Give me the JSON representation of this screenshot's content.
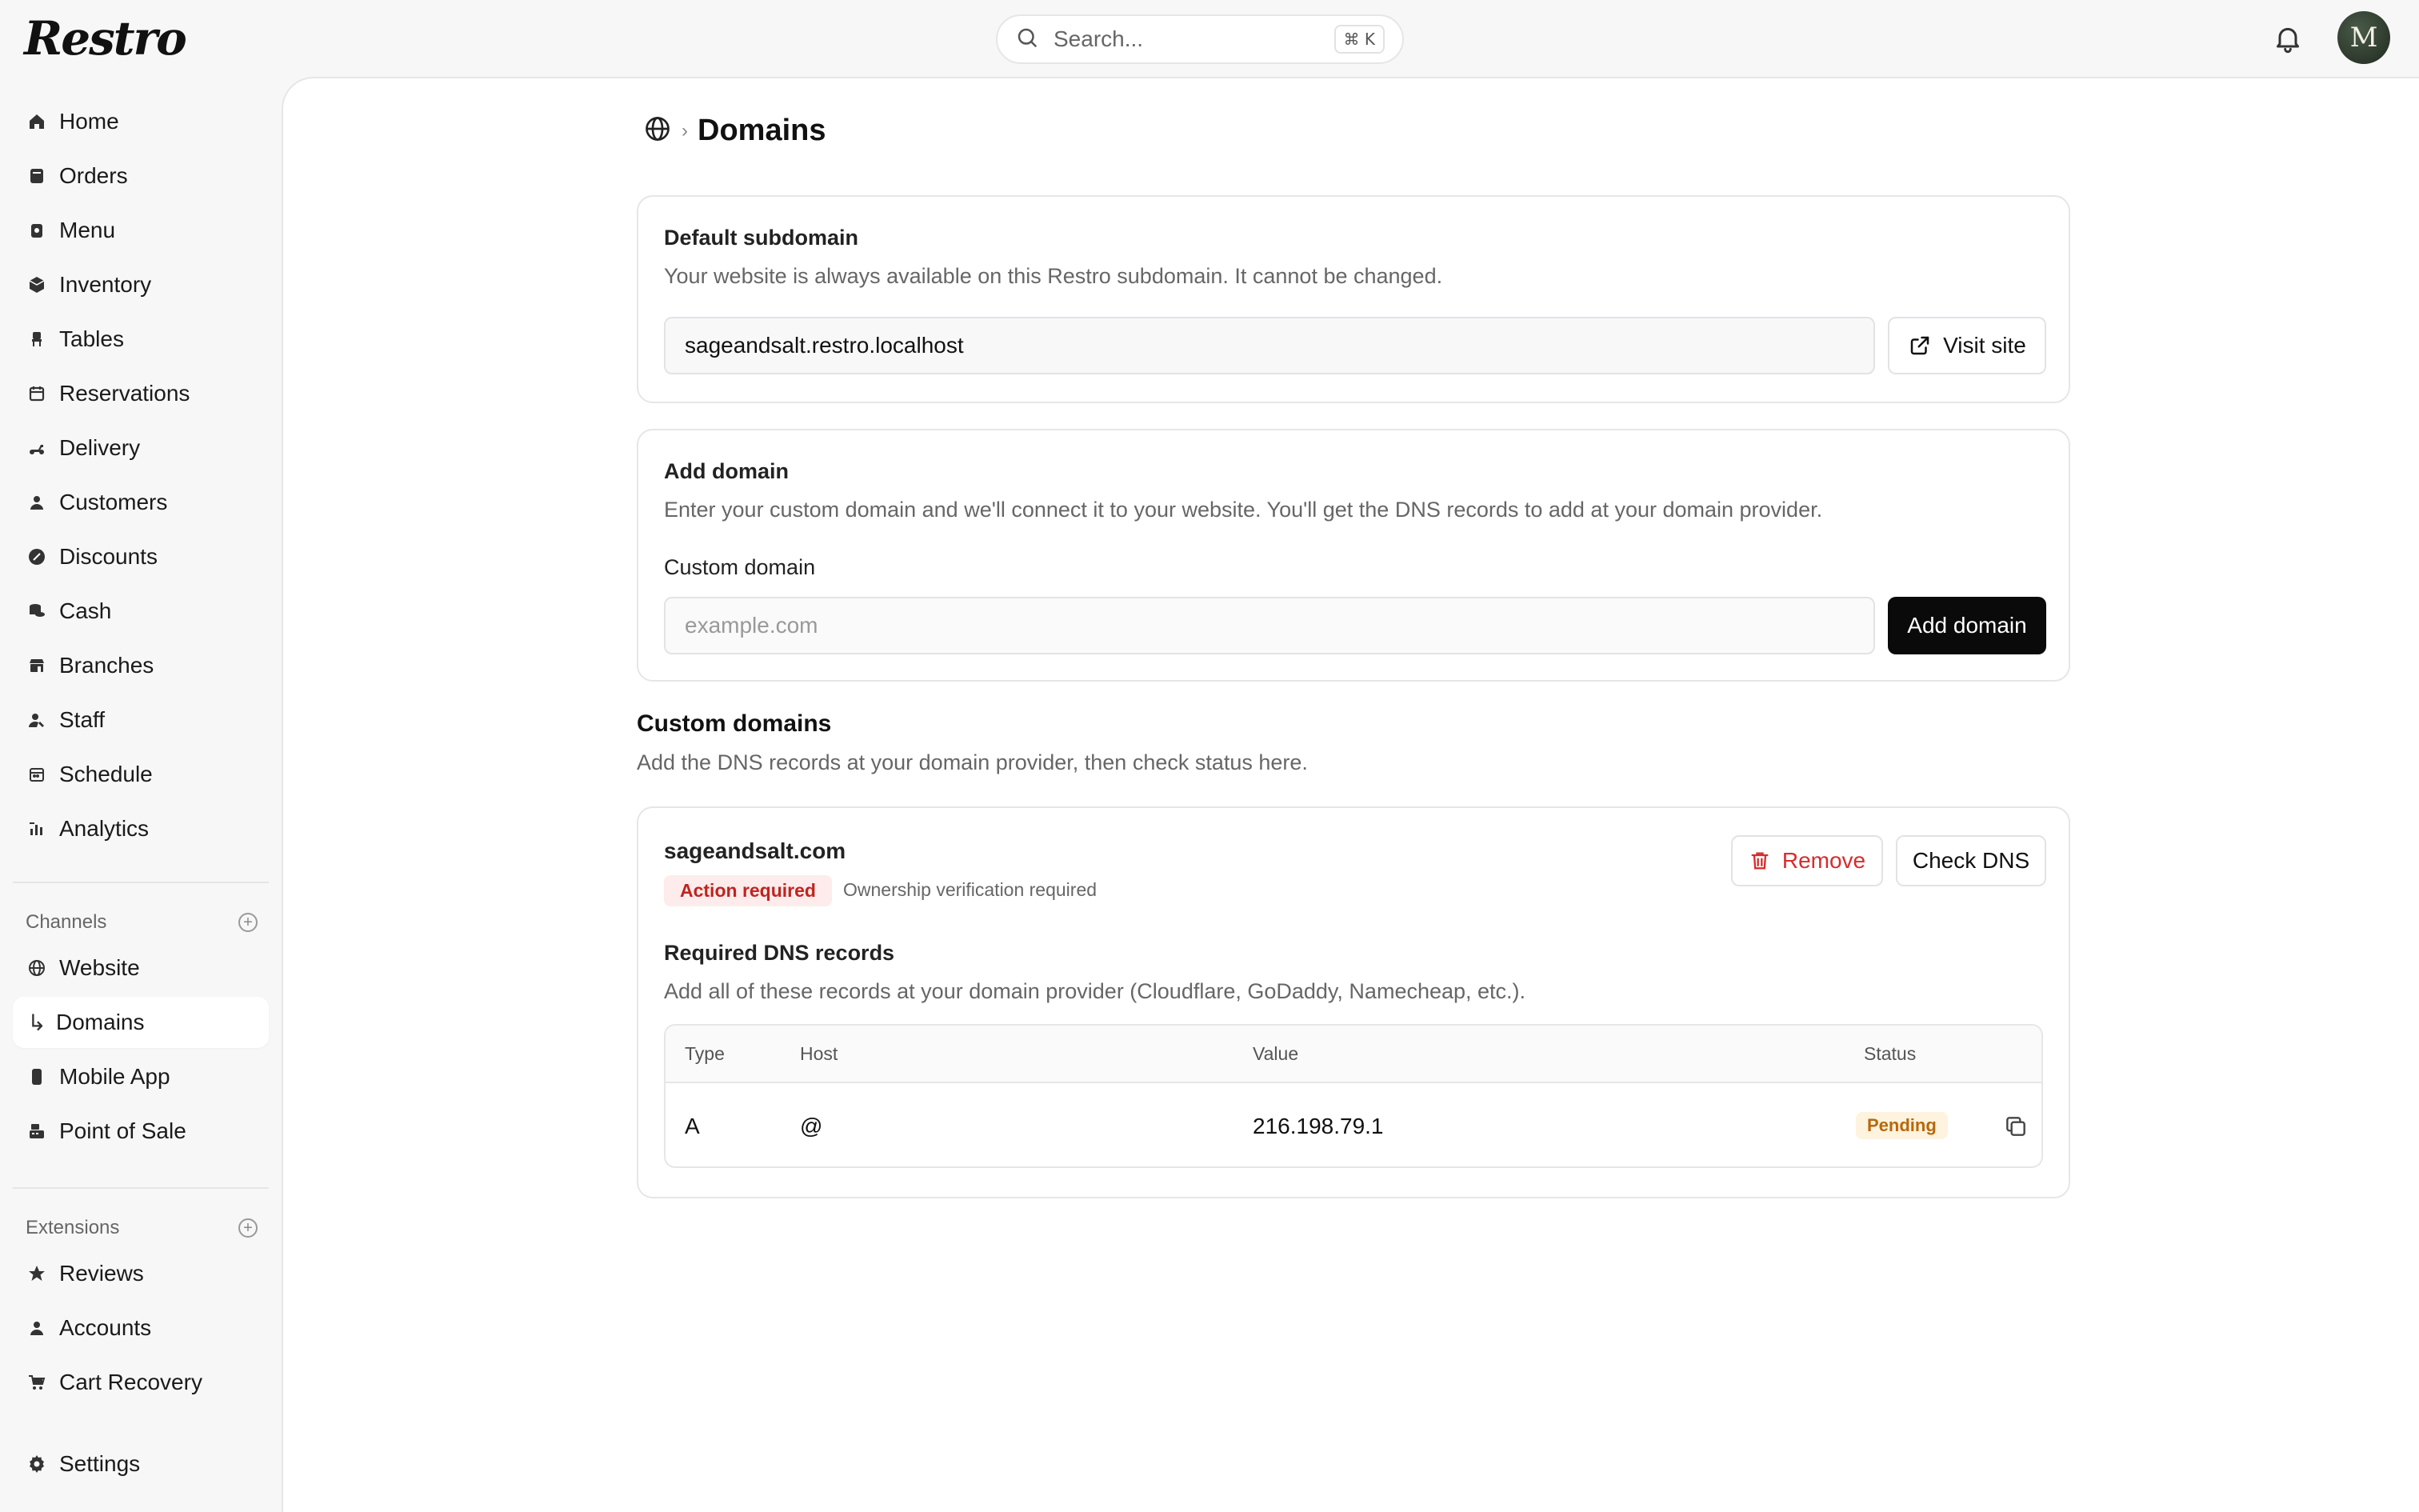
{
  "app": {
    "logo": "Restro",
    "search_placeholder": "Search...",
    "search_shortcut": "⌘ K",
    "avatar_initial": "M"
  },
  "sidebar": {
    "main": [
      {
        "label": "Home",
        "icon": "home-icon"
      },
      {
        "label": "Orders",
        "icon": "orders-icon"
      },
      {
        "label": "Menu",
        "icon": "menu-icon"
      },
      {
        "label": "Inventory",
        "icon": "inventory-icon"
      },
      {
        "label": "Tables",
        "icon": "tables-icon"
      },
      {
        "label": "Reservations",
        "icon": "calendar-icon"
      },
      {
        "label": "Delivery",
        "icon": "scooter-icon"
      },
      {
        "label": "Customers",
        "icon": "user-icon"
      },
      {
        "label": "Discounts",
        "icon": "discount-icon"
      },
      {
        "label": "Cash",
        "icon": "cash-icon"
      },
      {
        "label": "Branches",
        "icon": "store-icon"
      },
      {
        "label": "Staff",
        "icon": "staff-icon"
      },
      {
        "label": "Schedule",
        "icon": "schedule-icon"
      },
      {
        "label": "Analytics",
        "icon": "chart-icon"
      }
    ],
    "channels_heading": "Channels",
    "channels": [
      {
        "label": "Website",
        "icon": "globe-icon"
      },
      {
        "label": "Domains",
        "icon": "arrow-return-icon",
        "active": true
      },
      {
        "label": "Mobile App",
        "icon": "phone-icon"
      },
      {
        "label": "Point of Sale",
        "icon": "pos-icon"
      }
    ],
    "extensions_heading": "Extensions",
    "extensions": [
      {
        "label": "Reviews",
        "icon": "star-icon"
      },
      {
        "label": "Accounts",
        "icon": "user-icon"
      },
      {
        "label": "Cart Recovery",
        "icon": "cart-icon"
      }
    ],
    "settings": {
      "label": "Settings",
      "icon": "gear-icon"
    }
  },
  "page": {
    "title": "Domains"
  },
  "default_subdomain": {
    "title": "Default subdomain",
    "description": "Your website is always available on this Restro subdomain. It cannot be changed.",
    "value": "sageandsalt.restro.localhost",
    "visit_label": "Visit site"
  },
  "add_domain": {
    "title": "Add domain",
    "description": "Enter your custom domain and we'll connect it to your website. You'll get the DNS records to add at your domain provider.",
    "field_label": "Custom domain",
    "placeholder": "example.com",
    "button_label": "Add domain"
  },
  "custom_domains": {
    "heading": "Custom domains",
    "description": "Add the DNS records at your domain provider, then check status here.",
    "domain": {
      "name": "sageandsalt.com",
      "status_badge": "Action required",
      "status_text": "Ownership verification required",
      "remove_label": "Remove",
      "check_label": "Check DNS",
      "records_title": "Required DNS records",
      "records_description": "Add all of these records at your domain provider (Cloudflare, GoDaddy, Namecheap, etc.).",
      "columns": [
        "Type",
        "Host",
        "Value",
        "Status"
      ],
      "rows": [
        {
          "type": "A",
          "host": "@",
          "value": "216.198.79.1",
          "status": "Pending"
        }
      ]
    }
  },
  "colors": {
    "accent_dark": "#0a0a0a",
    "danger": "#d92b2b",
    "pending": "#b8680a"
  }
}
